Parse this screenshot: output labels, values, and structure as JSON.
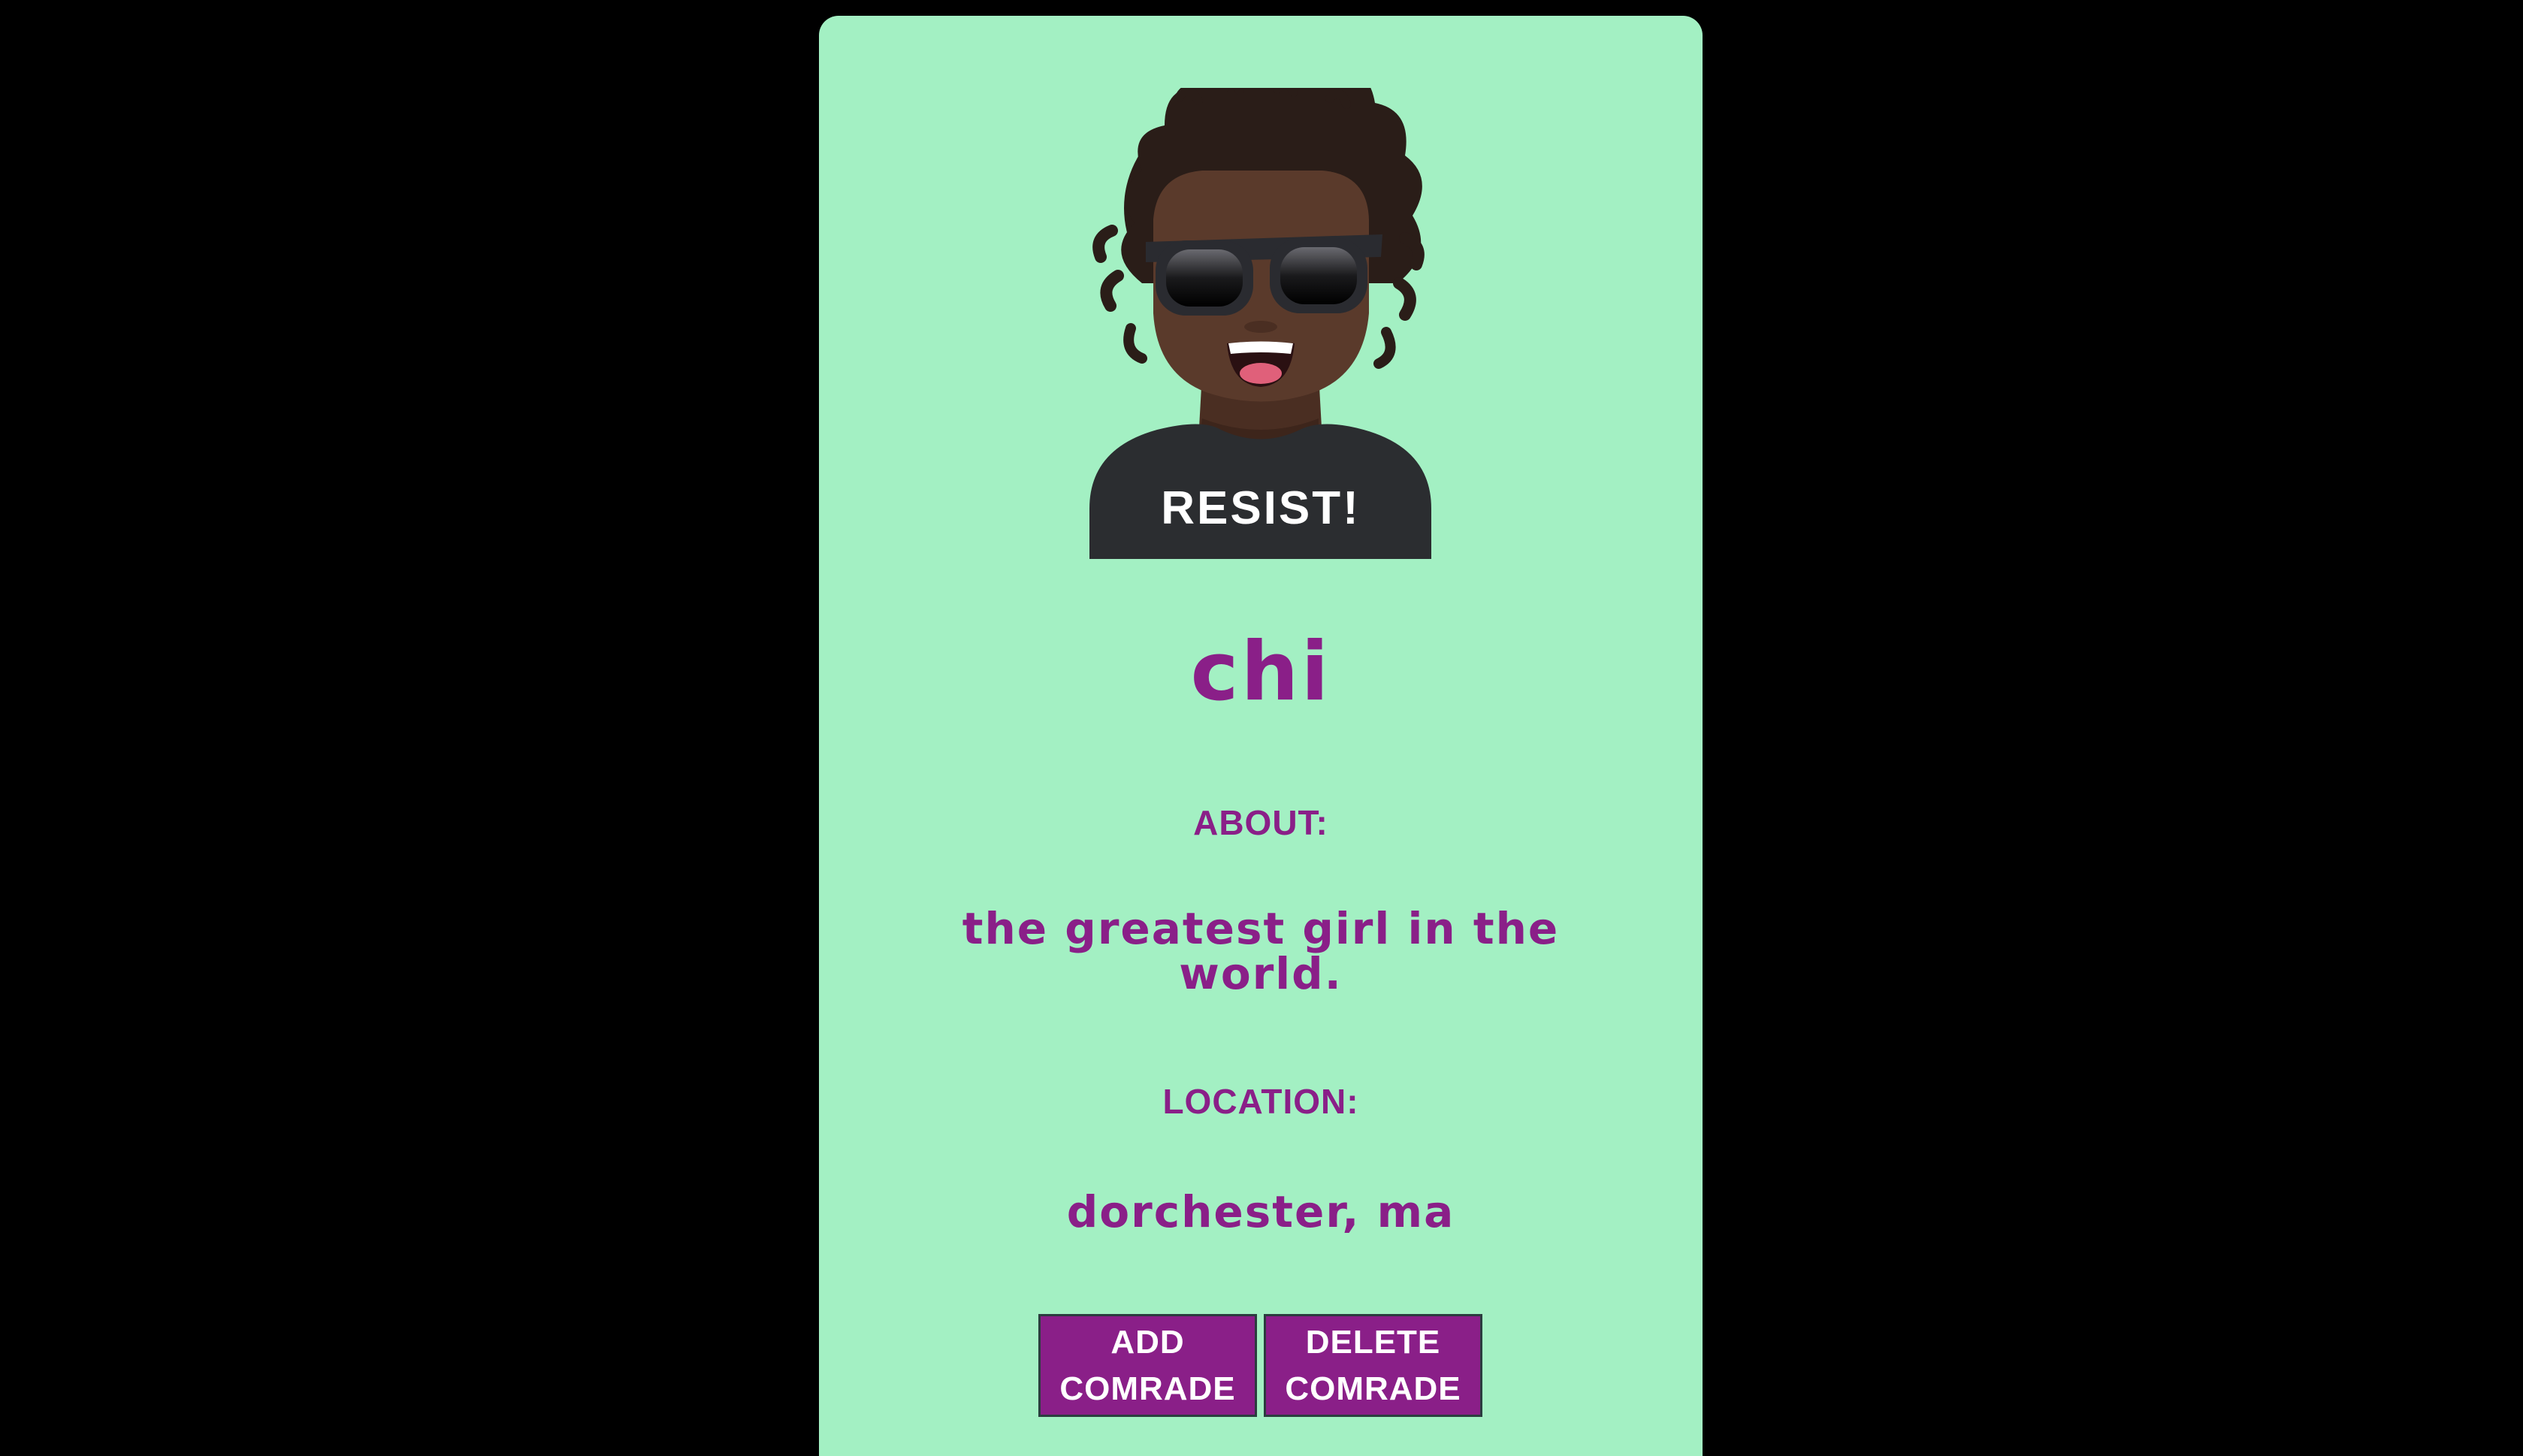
{
  "profile": {
    "avatar_shirt_text": "RESIST!",
    "username": "chi",
    "about_label": "ABOUT:",
    "about_text": "the greatest girl in the world.",
    "location_label": "LOCATION:",
    "location_text": "dorchester, ma"
  },
  "actions": {
    "add": {
      "line1": "ADD",
      "line2": "COMRADE"
    },
    "delete": {
      "line1": "DELETE",
      "line2": "COMRADE"
    }
  },
  "colors": {
    "background": "#000000",
    "card": "#a3f0c3",
    "accent": "#8a1f88",
    "button_text": "#ffffff"
  },
  "icons": {
    "avatar": "avatar-icon"
  }
}
